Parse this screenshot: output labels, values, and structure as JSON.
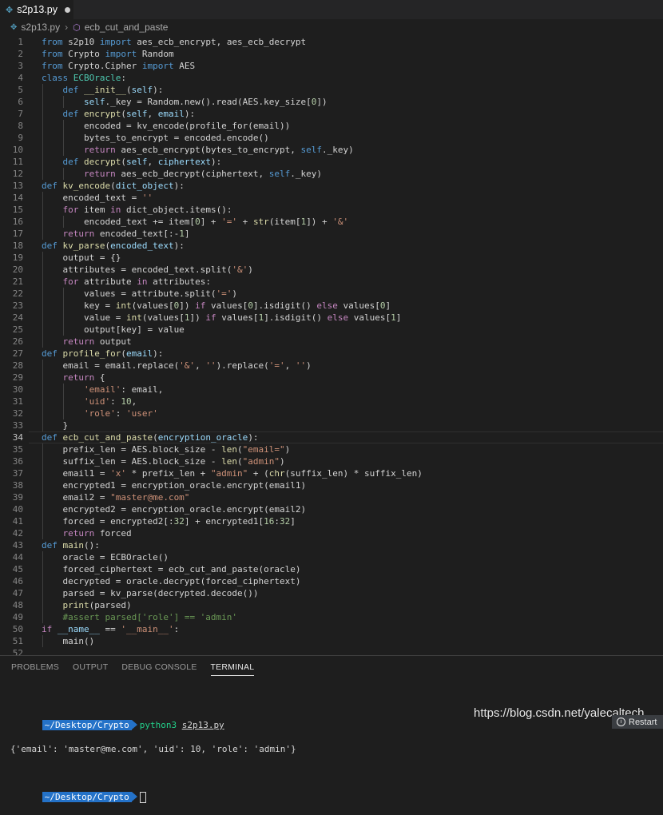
{
  "tab": {
    "filename": "s2p13.py",
    "icon": "python-file-icon"
  },
  "breadcrumb": {
    "file": "s2p13.py",
    "symbol": "ecb_cut_and_paste"
  },
  "code_lines": [
    [
      [
        "k",
        "from"
      ],
      [
        "v",
        " s2p10 "
      ],
      [
        "k",
        "import"
      ],
      [
        "v",
        " aes_ecb_encrypt, aes_ecb_decrypt"
      ]
    ],
    [
      [
        "k",
        "from"
      ],
      [
        "v",
        " Crypto "
      ],
      [
        "k",
        "import"
      ],
      [
        "v",
        " Random"
      ]
    ],
    [
      [
        "k",
        "from"
      ],
      [
        "v",
        " Crypto.Cipher "
      ],
      [
        "k",
        "import"
      ],
      [
        "v",
        " AES"
      ]
    ],
    [
      [
        "k",
        "class"
      ],
      [
        "v",
        " "
      ],
      [
        "cl",
        "ECBOracle"
      ],
      [
        "v",
        ":"
      ]
    ],
    [
      [
        "v",
        "    "
      ],
      [
        "k",
        "def"
      ],
      [
        "v",
        " "
      ],
      [
        "f",
        "__init__"
      ],
      [
        "v",
        "("
      ],
      [
        "p",
        "self"
      ],
      [
        "v",
        "):"
      ]
    ],
    [
      [
        "v",
        "        "
      ],
      [
        "p",
        "self"
      ],
      [
        "v",
        "._key = Random.new().read(AES.key_size["
      ],
      [
        "n",
        "0"
      ],
      [
        "v",
        "])"
      ]
    ],
    [
      [
        "v",
        "    "
      ],
      [
        "k",
        "def"
      ],
      [
        "v",
        " "
      ],
      [
        "f",
        "encrypt"
      ],
      [
        "v",
        "("
      ],
      [
        "p",
        "self"
      ],
      [
        "v",
        ", "
      ],
      [
        "p",
        "email"
      ],
      [
        "v",
        "):"
      ]
    ],
    [
      [
        "v",
        "        encoded = kv_encode(profile_for(email))"
      ]
    ],
    [
      [
        "v",
        "        bytes_to_encrypt = encoded.encode()"
      ]
    ],
    [
      [
        "v",
        "        "
      ],
      [
        "c",
        "return"
      ],
      [
        "v",
        " aes_ecb_encrypt(bytes_to_encrypt, "
      ],
      [
        "k",
        "self"
      ],
      [
        "v",
        "._key)"
      ]
    ],
    [
      [
        "v",
        "    "
      ],
      [
        "k",
        "def"
      ],
      [
        "v",
        " "
      ],
      [
        "f",
        "decrypt"
      ],
      [
        "v",
        "("
      ],
      [
        "p",
        "self"
      ],
      [
        "v",
        ", "
      ],
      [
        "p",
        "ciphertext"
      ],
      [
        "v",
        "):"
      ]
    ],
    [
      [
        "v",
        "        "
      ],
      [
        "c",
        "return"
      ],
      [
        "v",
        " aes_ecb_decrypt(ciphertext, "
      ],
      [
        "k",
        "self"
      ],
      [
        "v",
        "._key)"
      ]
    ],
    [
      [
        "k",
        "def"
      ],
      [
        "v",
        " "
      ],
      [
        "f",
        "kv_encode"
      ],
      [
        "v",
        "("
      ],
      [
        "p",
        "dict_object"
      ],
      [
        "v",
        "):"
      ]
    ],
    [
      [
        "v",
        "    encoded_text = "
      ],
      [
        "s",
        "''"
      ]
    ],
    [
      [
        "v",
        "    "
      ],
      [
        "c",
        "for"
      ],
      [
        "v",
        " item "
      ],
      [
        "c",
        "in"
      ],
      [
        "v",
        " dict_object.items():"
      ]
    ],
    [
      [
        "v",
        "        encoded_text += item["
      ],
      [
        "n",
        "0"
      ],
      [
        "v",
        "] + "
      ],
      [
        "s",
        "'='"
      ],
      [
        "v",
        " + "
      ],
      [
        "f",
        "str"
      ],
      [
        "v",
        "(item["
      ],
      [
        "n",
        "1"
      ],
      [
        "v",
        "]) + "
      ],
      [
        "s",
        "'&'"
      ]
    ],
    [
      [
        "v",
        "    "
      ],
      [
        "c",
        "return"
      ],
      [
        "v",
        " encoded_text[:-"
      ],
      [
        "n",
        "1"
      ],
      [
        "v",
        "]"
      ]
    ],
    [
      [
        "k",
        "def"
      ],
      [
        "v",
        " "
      ],
      [
        "f",
        "kv_parse"
      ],
      [
        "v",
        "("
      ],
      [
        "p",
        "encoded_text"
      ],
      [
        "v",
        "):"
      ]
    ],
    [
      [
        "v",
        "    output = {}"
      ]
    ],
    [
      [
        "v",
        "    attributes = encoded_text.split("
      ],
      [
        "s",
        "'&'"
      ],
      [
        "v",
        ")"
      ]
    ],
    [
      [
        "v",
        "    "
      ],
      [
        "c",
        "for"
      ],
      [
        "v",
        " attribute "
      ],
      [
        "c",
        "in"
      ],
      [
        "v",
        " attributes:"
      ]
    ],
    [
      [
        "v",
        "        values = attribute.split("
      ],
      [
        "s",
        "'='"
      ],
      [
        "v",
        ")"
      ]
    ],
    [
      [
        "v",
        "        key = "
      ],
      [
        "f",
        "int"
      ],
      [
        "v",
        "(values["
      ],
      [
        "n",
        "0"
      ],
      [
        "v",
        "]) "
      ],
      [
        "c",
        "if"
      ],
      [
        "v",
        " values["
      ],
      [
        "n",
        "0"
      ],
      [
        "v",
        "].isdigit() "
      ],
      [
        "c",
        "else"
      ],
      [
        "v",
        " values["
      ],
      [
        "n",
        "0"
      ],
      [
        "v",
        "]"
      ]
    ],
    [
      [
        "v",
        "        value = "
      ],
      [
        "f",
        "int"
      ],
      [
        "v",
        "(values["
      ],
      [
        "n",
        "1"
      ],
      [
        "v",
        "]) "
      ],
      [
        "c",
        "if"
      ],
      [
        "v",
        " values["
      ],
      [
        "n",
        "1"
      ],
      [
        "v",
        "].isdigit() "
      ],
      [
        "c",
        "else"
      ],
      [
        "v",
        " values["
      ],
      [
        "n",
        "1"
      ],
      [
        "v",
        "]"
      ]
    ],
    [
      [
        "v",
        "        output[key] = value"
      ]
    ],
    [
      [
        "v",
        "    "
      ],
      [
        "c",
        "return"
      ],
      [
        "v",
        " output"
      ]
    ],
    [
      [
        "k",
        "def"
      ],
      [
        "v",
        " "
      ],
      [
        "f",
        "profile_for"
      ],
      [
        "v",
        "("
      ],
      [
        "p",
        "email"
      ],
      [
        "v",
        "):"
      ]
    ],
    [
      [
        "v",
        "    email = email.replace("
      ],
      [
        "s",
        "'&'"
      ],
      [
        "v",
        ", "
      ],
      [
        "s",
        "''"
      ],
      [
        "v",
        ").replace("
      ],
      [
        "s",
        "'='"
      ],
      [
        "v",
        ", "
      ],
      [
        "s",
        "''"
      ],
      [
        "v",
        ")"
      ]
    ],
    [
      [
        "v",
        "    "
      ],
      [
        "c",
        "return"
      ],
      [
        "v",
        " {"
      ]
    ],
    [
      [
        "v",
        "        "
      ],
      [
        "s",
        "'email'"
      ],
      [
        "v",
        ": email,"
      ]
    ],
    [
      [
        "v",
        "        "
      ],
      [
        "s",
        "'uid'"
      ],
      [
        "v",
        ": "
      ],
      [
        "n",
        "10"
      ],
      [
        "v",
        ","
      ]
    ],
    [
      [
        "v",
        "        "
      ],
      [
        "s",
        "'role'"
      ],
      [
        "v",
        ": "
      ],
      [
        "s",
        "'user'"
      ]
    ],
    [
      [
        "v",
        "    }"
      ]
    ],
    [
      [
        "k",
        "def"
      ],
      [
        "v",
        " "
      ],
      [
        "f",
        "ecb_cut_and_paste"
      ],
      [
        "v",
        "("
      ],
      [
        "p",
        "encryption_oracle"
      ],
      [
        "v",
        "):"
      ]
    ],
    [
      [
        "v",
        "    prefix_len = AES.block_size - "
      ],
      [
        "f",
        "len"
      ],
      [
        "v",
        "("
      ],
      [
        "s",
        "\"email=\""
      ],
      [
        "v",
        ")"
      ]
    ],
    [
      [
        "v",
        "    suffix_len = AES.block_size - "
      ],
      [
        "f",
        "len"
      ],
      [
        "v",
        "("
      ],
      [
        "s",
        "\"admin\""
      ],
      [
        "v",
        ")"
      ]
    ],
    [
      [
        "v",
        "    email1 = "
      ],
      [
        "s",
        "'x'"
      ],
      [
        "v",
        " * prefix_len + "
      ],
      [
        "s",
        "\"admin\""
      ],
      [
        "v",
        " + ("
      ],
      [
        "f",
        "chr"
      ],
      [
        "v",
        "(suffix_len) * suffix_len)"
      ]
    ],
    [
      [
        "v",
        "    encrypted1 = encryption_oracle.encrypt(email1)"
      ]
    ],
    [
      [
        "v",
        "    email2 = "
      ],
      [
        "s",
        "\"master@me.com\""
      ]
    ],
    [
      [
        "v",
        "    encrypted2 = encryption_oracle.encrypt(email2)"
      ]
    ],
    [
      [
        "v",
        "    forced = encrypted2[:"
      ],
      [
        "n",
        "32"
      ],
      [
        "v",
        "] + encrypted1["
      ],
      [
        "n",
        "16"
      ],
      [
        "v",
        ":"
      ],
      [
        "n",
        "32"
      ],
      [
        "v",
        "]"
      ]
    ],
    [
      [
        "v",
        "    "
      ],
      [
        "c",
        "return"
      ],
      [
        "v",
        " forced"
      ]
    ],
    [
      [
        "k",
        "def"
      ],
      [
        "v",
        " "
      ],
      [
        "f",
        "main"
      ],
      [
        "v",
        "():"
      ]
    ],
    [
      [
        "v",
        "    oracle = ECBOracle()"
      ]
    ],
    [
      [
        "v",
        "    forced_ciphertext = ecb_cut_and_paste(oracle)"
      ]
    ],
    [
      [
        "v",
        "    decrypted = oracle.decrypt(forced_ciphertext)"
      ]
    ],
    [
      [
        "v",
        "    parsed = kv_parse(decrypted.decode())"
      ]
    ],
    [
      [
        "v",
        "    "
      ],
      [
        "f",
        "print"
      ],
      [
        "v",
        "(parsed)"
      ]
    ],
    [
      [
        "v",
        "    "
      ],
      [
        "cm",
        "#assert parsed['role'] == 'admin'"
      ]
    ],
    [
      [
        "c",
        "if"
      ],
      [
        "v",
        " "
      ],
      [
        "p",
        "__name__"
      ],
      [
        "v",
        " == "
      ],
      [
        "s",
        "'__main__'"
      ],
      [
        "v",
        ":"
      ]
    ],
    [
      [
        "v",
        "    main()"
      ]
    ],
    []
  ],
  "panel": {
    "tabs": [
      "PROBLEMS",
      "OUTPUT",
      "DEBUG CONSOLE",
      "TERMINAL"
    ],
    "active_tab": "TERMINAL"
  },
  "terminal": {
    "prompt": "~/Desktop/Crypto",
    "command_name": "python3",
    "command_arg": "s2p13.py",
    "output": "{'email': 'master@me.com', 'uid': 10, 'role': 'admin'}"
  },
  "watermark": "https://blog.csdn.net/yalecaltech",
  "restart_label": "Restart",
  "colors": {
    "keyword": "#569cd6",
    "control": "#c586c0",
    "function": "#dcdcaa",
    "string": "#ce9178",
    "number": "#b5cea8",
    "comment": "#6a9955",
    "prompt_bg": "#2472c8",
    "command": "#23d18b"
  }
}
